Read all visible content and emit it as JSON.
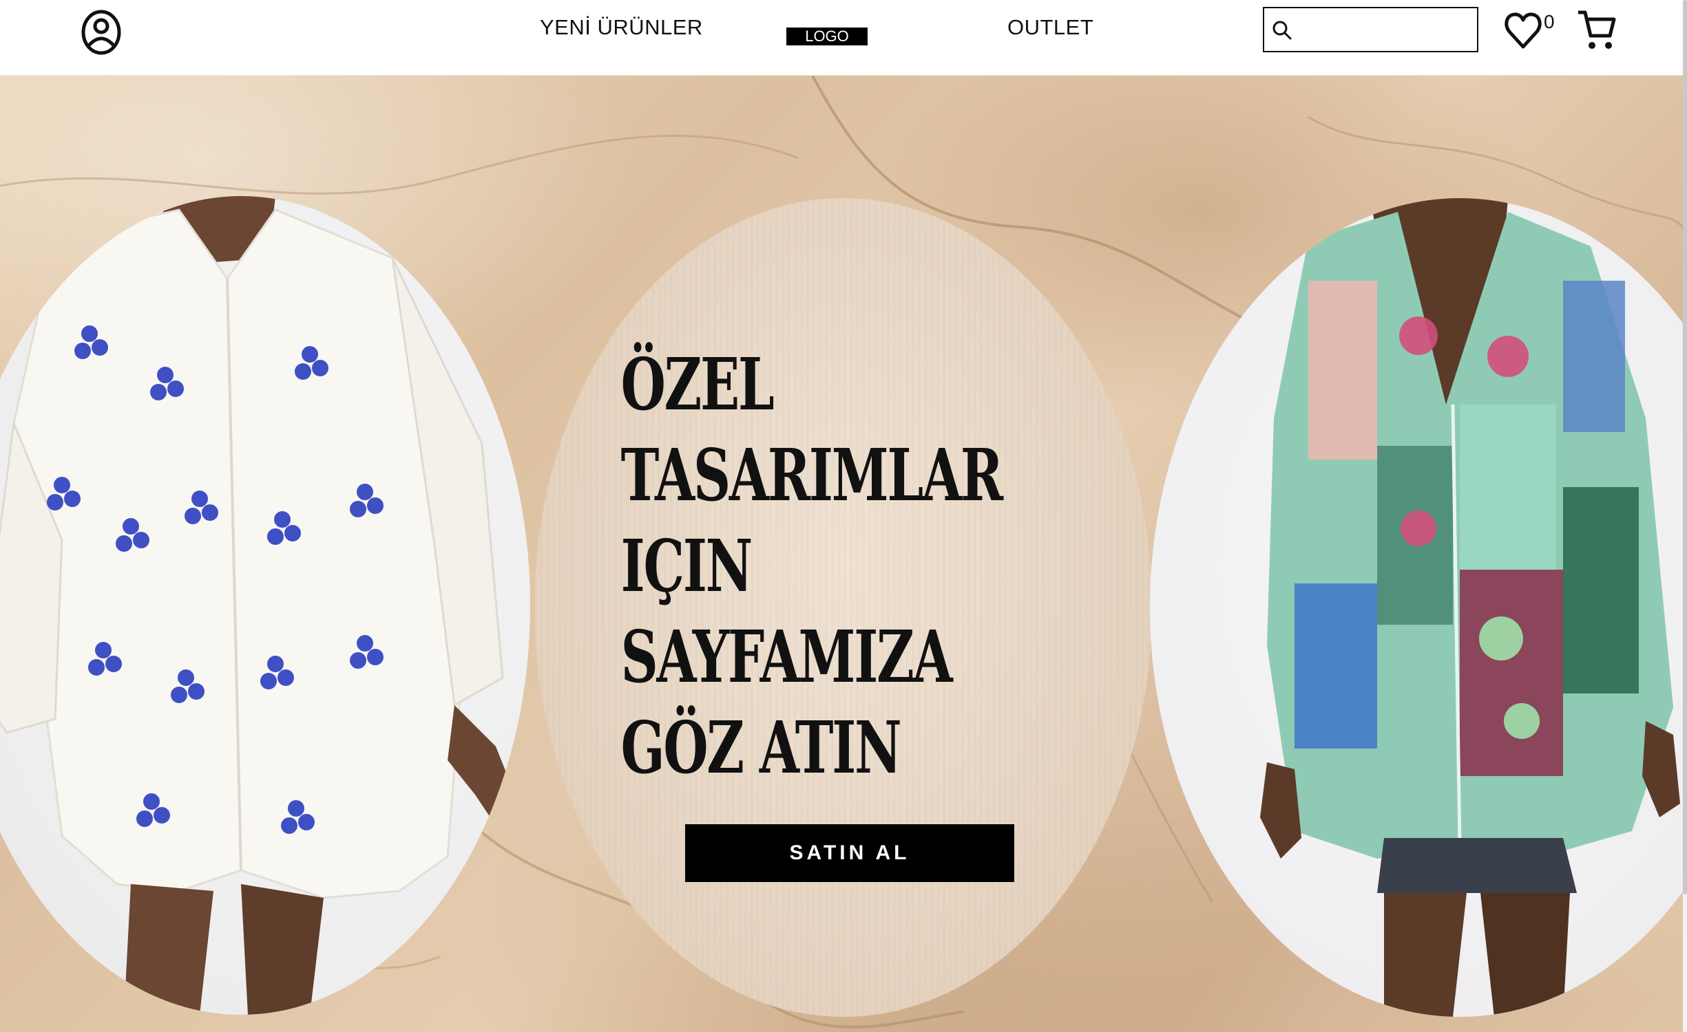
{
  "header": {
    "nav": {
      "new_products": "YENİ ÜRÜNLER",
      "logo": "LOGO",
      "outlet": "OUTLET"
    },
    "search": {
      "value": "",
      "placeholder": ""
    },
    "wishlist_count": "0",
    "icons": {
      "account": "account-circle-icon",
      "search": "search-icon",
      "wishlist": "heart-icon",
      "cart": "cart-icon"
    }
  },
  "hero": {
    "headline_lines": [
      "ÖZEL",
      "TASARIMLAR",
      "IÇIN",
      "SAYFAMIZA",
      "GÖZ ATIN"
    ],
    "cta_label": "SATIN AL",
    "images": {
      "left": "model-white-floral-shirt",
      "right": "model-patchwork-print-shirt"
    }
  },
  "colors": {
    "accent": "#000000",
    "background_marble": "#e2c8a8",
    "text": "#111111"
  }
}
